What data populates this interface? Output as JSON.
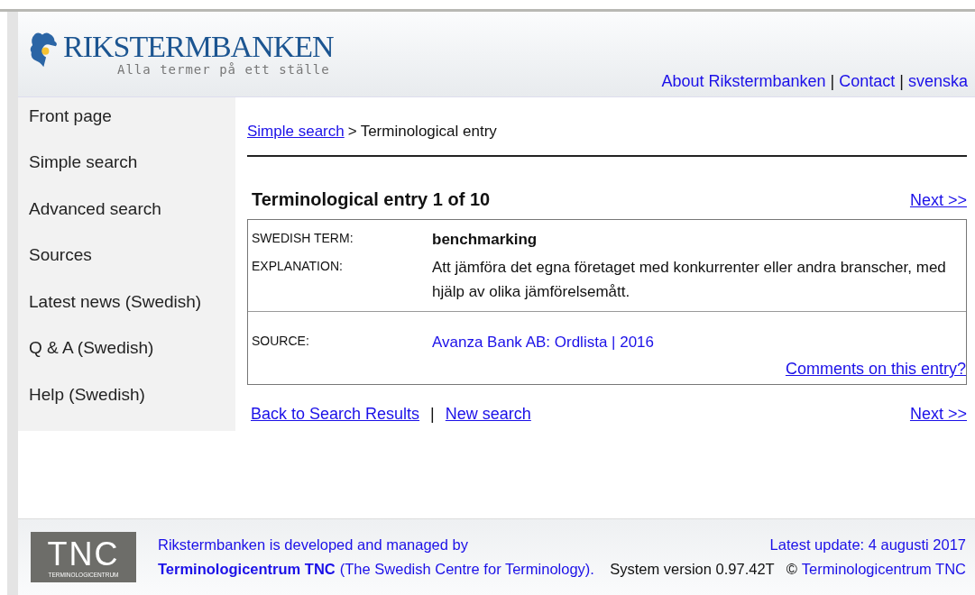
{
  "header": {
    "logo_title": "RIKSTERMBANKEN",
    "logo_tagline": "Alla termer på ett ställe",
    "links": [
      "About Rikstermbanken",
      "Contact",
      "svenska"
    ],
    "separator": "|"
  },
  "sidebar": {
    "items": [
      {
        "label": "Front page",
        "selected": false
      },
      {
        "label": "Simple search",
        "selected": false
      },
      {
        "label": "Advanced search",
        "selected": false
      },
      {
        "label": "Sources",
        "selected": false
      },
      {
        "label": "Latest news (Swedish)",
        "selected": false
      },
      {
        "label": "Q & A (Swedish)",
        "selected": false
      },
      {
        "label": "Help (Swedish)",
        "selected": false
      }
    ]
  },
  "breadcrumb": {
    "link": "Simple search ",
    "separator": ">",
    "current": "Terminological entry"
  },
  "entry": {
    "heading": "Terminological entry 1 of 10",
    "next": "Next >>",
    "fields": [
      {
        "label": "SWEDISH TERM:",
        "value": "benchmarking",
        "kind": "term"
      },
      {
        "label": "EXPLANATION:",
        "value": "Att jämföra det egna företaget med konkurrenter eller andra branscher, med hjälp av olika jämförelsemått.",
        "kind": "text"
      }
    ],
    "source": {
      "label": "SOURCE:",
      "value": "Avanza Bank AB: Ordlista | 2016"
    },
    "comments": "Comments on this entry?"
  },
  "bottom_links": {
    "back": "Back to Search Results",
    "separator": "|",
    "new": "New search",
    "next": "Next >>"
  },
  "footer": {
    "tnc_logo": "TNC",
    "tnc_logo_sub": "TERMINOLOGICENTRUM",
    "line1": "Rikstermbanken is developed and managed by",
    "org_link": "Terminologicentrum TNC",
    "org_desc": "(The Swedish Centre for Terminology).",
    "update": "Latest update: 4 augusti 2017",
    "version": "System version 0.97.42T",
    "copyright": "©",
    "copyright_link": "Terminologicentrum TNC"
  }
}
